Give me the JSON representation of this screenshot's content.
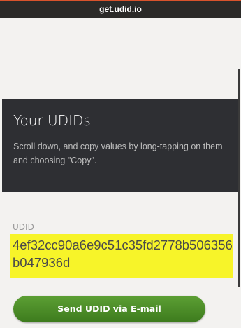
{
  "browser": {
    "url": "get.udid.io"
  },
  "hero": {
    "title": "Your UDIDs",
    "description": "Scroll down, and copy values by long-tapping on them and choosing \"Copy\"."
  },
  "udid": {
    "label": "UDID",
    "value": "4ef32cc90a6e9c51c35fd2778b506356b047936d"
  },
  "actions": {
    "send_email_label": "Send UDID via E-mail"
  },
  "colors": {
    "header_bg": "#2b2a28",
    "accent_line": "#d9532c",
    "hero_bg": "#2e2f33",
    "highlight": "#f7f429",
    "button_green": "#4b8c27"
  }
}
